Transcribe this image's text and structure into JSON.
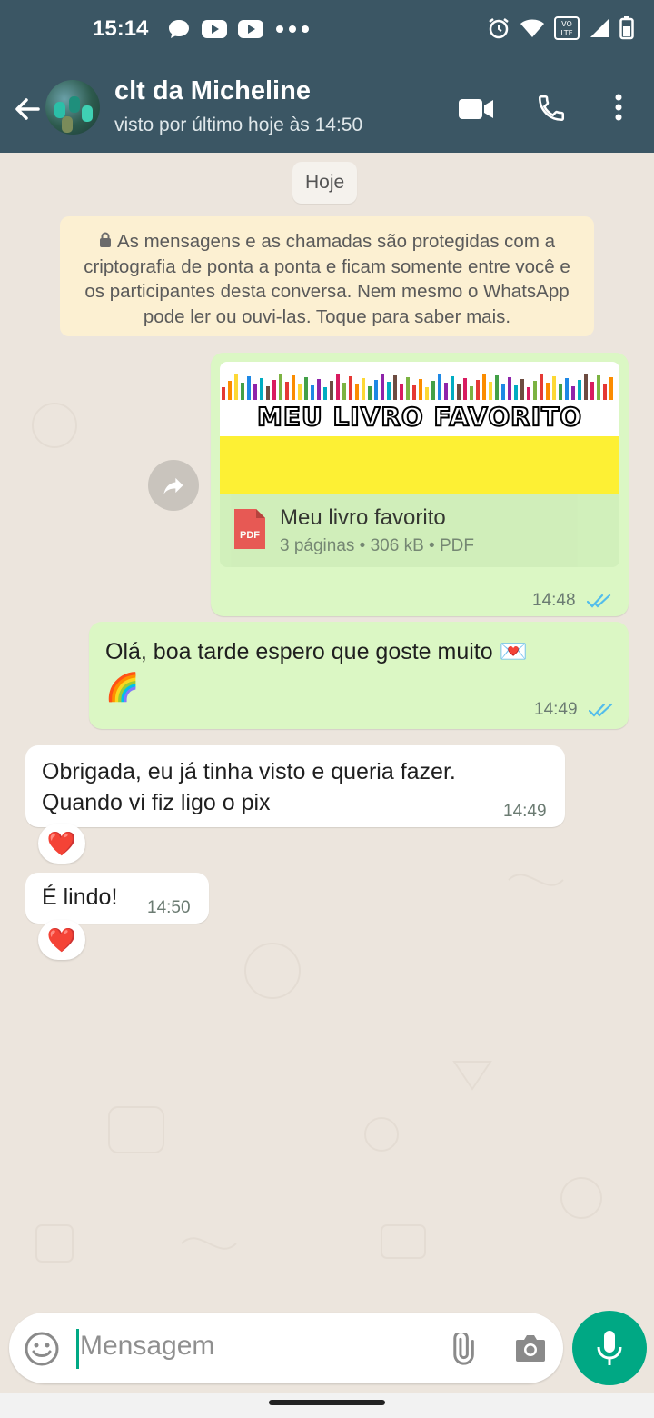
{
  "status_bar": {
    "time": "15:14"
  },
  "header": {
    "contact_name": "clt da Micheline",
    "last_seen": "visto por último hoje às 14:50"
  },
  "chat": {
    "date_chip": "Hoje",
    "encryption_notice": "As mensagens e as chamadas são protegidas com a criptografia de ponta a ponta e ficam somente entre você e os participantes desta conversa. Nem mesmo o WhatsApp pode ler ou ouvi-las. Toque para saber mais.",
    "messages": [
      {
        "direction": "out",
        "type": "document",
        "preview_title": "MEU LIVRO FAVORITO",
        "file_name": "Meu livro favorito",
        "file_meta": "3 páginas • 306 kB • PDF",
        "file_type_label": "PDF",
        "time": "14:48",
        "status": "read"
      },
      {
        "direction": "out",
        "type": "text",
        "text": "Olá, boa tarde espero que goste muito 💌",
        "text_line2": "🌈",
        "time": "14:49",
        "status": "read"
      },
      {
        "direction": "in",
        "type": "text",
        "text_line1": "Obrigada, eu já tinha visto e queria fazer.",
        "text_line2": "Quando vi fiz ligo o pix",
        "time": "14:49",
        "reaction": "❤️"
      },
      {
        "direction": "in",
        "type": "text",
        "text": "É lindo!",
        "time": "14:50",
        "reaction": "❤️"
      }
    ]
  },
  "composer": {
    "placeholder": "Mensagem"
  },
  "colors": {
    "header": "#3b5664",
    "outgoing_bubble": "#dbf7c4",
    "incoming_bubble": "#ffffff",
    "accent": "#00a884",
    "read_ticks": "#53bdeb"
  }
}
